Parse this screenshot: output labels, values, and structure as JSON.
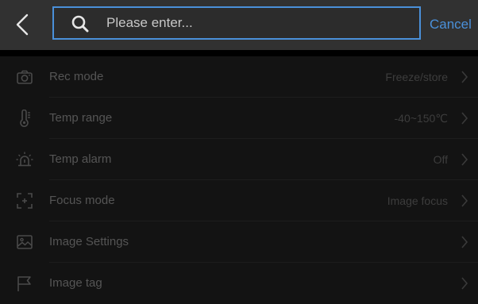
{
  "header": {
    "back_icon": "chevron-left-icon",
    "search": {
      "placeholder": "Please enter...",
      "value": "",
      "icon": "search-icon"
    },
    "cancel_label": "Cancel",
    "accent_color": "#4a90d9"
  },
  "settings": [
    {
      "icon": "camera-icon",
      "label": "Rec mode",
      "value": "Freeze/store"
    },
    {
      "icon": "thermometer-icon",
      "label": "Temp range",
      "value": "-40~150℃"
    },
    {
      "icon": "alarm-light-icon",
      "label": "Temp alarm",
      "value": "Off"
    },
    {
      "icon": "focus-frame-icon",
      "label": "Focus mode",
      "value": "Image focus"
    },
    {
      "icon": "image-icon",
      "label": "Image Settings",
      "value": ""
    },
    {
      "icon": "flag-icon",
      "label": "Image tag",
      "value": ""
    }
  ]
}
